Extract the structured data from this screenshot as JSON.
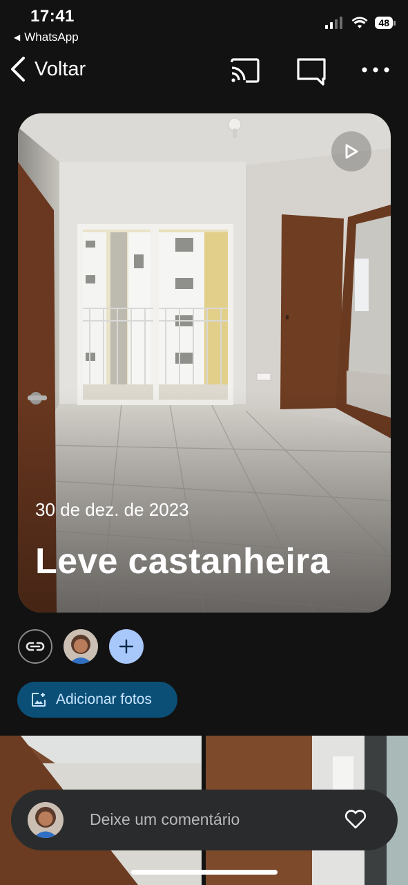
{
  "status_bar": {
    "time": "17:41",
    "back_app": "WhatsApp",
    "battery": "48"
  },
  "nav": {
    "back_label": "Voltar",
    "icons": [
      "cast-icon",
      "comment-icon",
      "more-icon"
    ]
  },
  "album": {
    "date": "30 de dez. de 2023",
    "title": "Leve castanheira"
  },
  "actions": {
    "add_photos_label": "Adicionar fotos"
  },
  "comment": {
    "placeholder": "Deixe um comentário"
  },
  "colors": {
    "background": "#121212",
    "accent_button": "#0b4f77",
    "add_circle": "#a8c7fa"
  }
}
